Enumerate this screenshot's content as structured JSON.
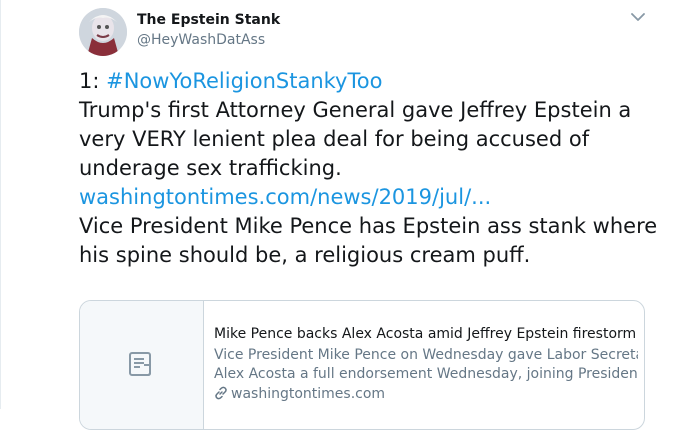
{
  "tweet": {
    "display_name": "The Epstein Stank",
    "handle": "@HeyWashDatAss",
    "caret_icon": "chevron-down-icon",
    "numbering": "1: ",
    "hashtag": "#NowYoReligionStankyToo",
    "text_line_1": "Trump's first Attorney General gave Jeffrey Epstein a",
    "text_line_2": "very VERY lenient plea deal for being accused of",
    "text_line_3": "underage sex trafficking.",
    "link": "washingtontimes.com/news/2019/jul/...",
    "text_line_4": "Vice President Mike Pence has Epstein ass stank where",
    "text_line_5": "his spine should be, a religious cream puff."
  },
  "card": {
    "icon": "document-icon",
    "title": "Mike Pence backs Alex Acosta amid Jeffrey Epstein firestorm",
    "description_line_1": "Vice President Mike Pence on Wednesday gave Labor Secretary",
    "description_line_2": "Alex Acosta a full endorsement Wednesday, joining President ...",
    "domain_icon": "link-icon",
    "domain": "washingtontimes.com"
  },
  "colors": {
    "link": "#1b95e0",
    "text": "#14171a",
    "secondary": "#657786",
    "border": "#ccd6dd"
  }
}
